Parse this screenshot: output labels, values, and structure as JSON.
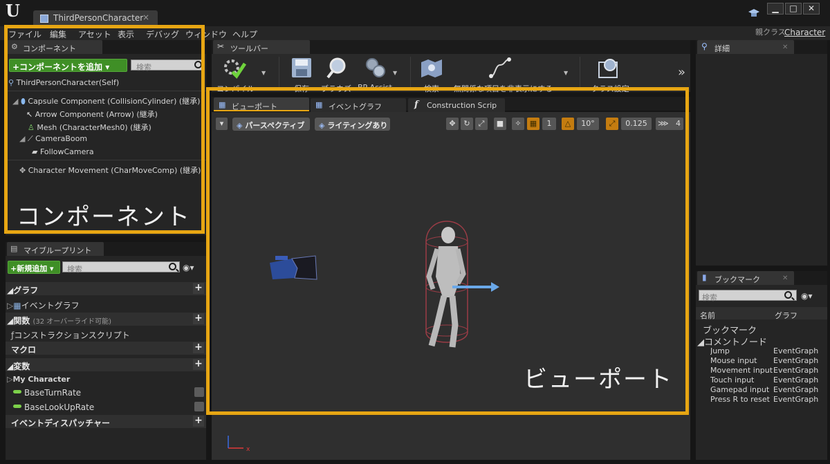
{
  "window": {
    "tab_title": "ThirdPersonCharacter",
    "tab_close": "×",
    "logo": "U",
    "controls": [
      "▁",
      "□",
      "✕"
    ],
    "parent_class_label": "親クラス",
    "parent_class_value": "Character"
  },
  "menu": [
    "ファイル",
    "編集",
    "アセット",
    "表示",
    "デバッグ",
    "ウィンドウ",
    "ヘルプ"
  ],
  "components_panel": {
    "tab_label": "コンポーネント",
    "add_button": "+コンポーネントを追加 ▾",
    "search_placeholder": "検索",
    "tree": [
      "ThirdPersonCharacter(Self)",
      "Capsule Component (CollisionCylinder) (継承)",
      "Arrow Component (Arrow) (継承)",
      "Mesh (CharacterMesh0) (継承)",
      "CameraBoom",
      "FollowCamera",
      "Character Movement (CharMoveComp) (継承)"
    ],
    "annotation": "コンポーネント"
  },
  "myblueprint_panel": {
    "tab_label": "マイブループリント",
    "add_button": "+新規追加 ▾",
    "search_placeholder": "検索",
    "sections": {
      "graphs": "グラフ",
      "event_graph": "イベントグラフ",
      "functions": "関数",
      "functions_note": "(32 オーバーライド可能)",
      "construction_script": "コンストラクションスクリプト",
      "macros": "マクロ",
      "variables": "変数",
      "category": "My Character",
      "var1": "BaseTurnRate",
      "var2": "BaseLookUpRate",
      "dispatchers": "イベントディスパッチャー"
    }
  },
  "toolbar": {
    "tab_label": "ツールバー",
    "compile": "コンパイル",
    "save": "保存",
    "browse": "ブラウズ",
    "bp_assist": "BP Assist",
    "search": "検索",
    "hide_unrelated": "無関係な項目を非表示にする",
    "class_settings": "クラス設定",
    "overflow": "»"
  },
  "editor_tabs": {
    "viewport": "ビューポート",
    "event_graph": "イベントグラフ",
    "construction_script": "Construction Scrip"
  },
  "viewport": {
    "perspective": "パースペクティブ",
    "lighting": "ライティングあり",
    "grid_size": "1",
    "rotation_snap": "10°",
    "scale_snap": "0.125",
    "camera_speed": "4",
    "annotation": "ビューポート"
  },
  "details_panel": {
    "tab_label": "詳細"
  },
  "bookmarks_panel": {
    "tab_label": "ブックマーク",
    "search_placeholder": "検索",
    "col_name": "名前",
    "col_graph": "グラフ",
    "group_bookmarks": "ブックマーク",
    "group_comments": "◢コメントノード",
    "rows": [
      {
        "name": "Jump",
        "graph": "EventGraph"
      },
      {
        "name": "Mouse input",
        "graph": "EventGraph"
      },
      {
        "name": "Movement input",
        "graph": "EventGraph"
      },
      {
        "name": "Touch input",
        "graph": "EventGraph"
      },
      {
        "name": "Gamepad input",
        "graph": "EventGraph"
      },
      {
        "name": "Press R to reset V",
        "graph": "EventGraph"
      }
    ]
  },
  "colors": {
    "highlight": "#e7a613",
    "add_button": "#3f8f26",
    "panel": "#252525",
    "viewport": "#2f2f2f"
  }
}
